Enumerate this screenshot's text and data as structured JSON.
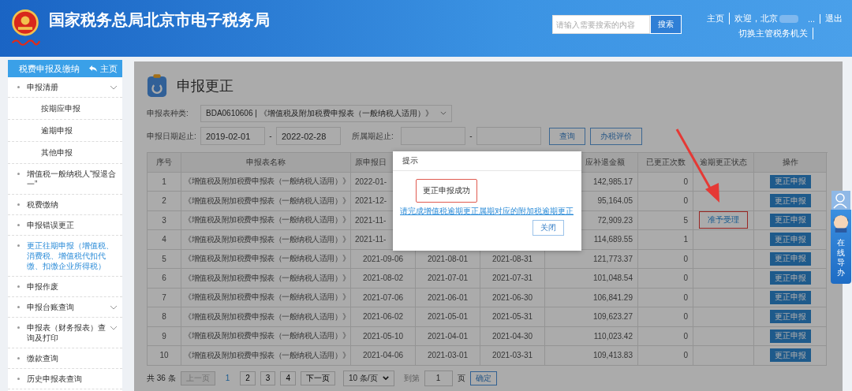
{
  "header": {
    "title": "国家税务总局北京市电子税务局",
    "search": {
      "placeholder": "请输入需要搜索的内容",
      "button": "搜索"
    },
    "links": [
      "主页",
      "欢迎，北京",
      "退出"
    ],
    "name_suffix": "...",
    "switch_link": "切换主管税务机关"
  },
  "sidebar": {
    "title": "税费申报及缴纳",
    "home": "主页",
    "items": [
      {
        "label": "申报清册",
        "expanded": true,
        "selected": false,
        "children": [
          {
            "label": "按期应申报"
          },
          {
            "label": "逾期申报"
          },
          {
            "label": "其他申报"
          }
        ]
      },
      {
        "label": "增值税一般纳税人“报退合一”",
        "selected": false
      },
      {
        "label": "税费缴纳",
        "selected": false
      },
      {
        "label": "申报错误更正",
        "selected": false
      },
      {
        "label": "更正往期申报（增值税、消费税、增值税代扣代缴、扣缴企业所得税）",
        "selected": true
      },
      {
        "label": "申报作废",
        "selected": false
      },
      {
        "label": "申报台账查询",
        "selected": false,
        "expandable": true
      },
      {
        "label": "申报表（财务报表）查询及打印",
        "selected": false,
        "expandable": true
      },
      {
        "label": "缴款查询",
        "selected": false
      },
      {
        "label": "历史申报表查询",
        "selected": false
      }
    ]
  },
  "page": {
    "title": "申报更正",
    "filters": {
      "type_label": "申报表种类:",
      "type_value": "BDA0610606 | 《增值税及附加税费申报表（一般纳税人适用）》",
      "date_label": "申报日期起止:",
      "date_from": "2019-02-01",
      "date_to": "2022-02-28",
      "dash": "-",
      "period_label": "所属期起止:",
      "period_dash": "-",
      "query": "查询",
      "rate": "办税评价"
    },
    "table": {
      "columns": [
        "序号",
        "申报表名称",
        "原申报日",
        "应补退金额",
        "已更正次数",
        "逾期更正状态",
        "操作"
      ],
      "rows": [
        {
          "no": "1",
          "name": "《增值税及附加税费申报表（一般纳税人适用）》",
          "filed": "2022-01-",
          "amount": "142,985.17",
          "count": "0",
          "action": "更正申报"
        },
        {
          "no": "2",
          "name": "《增值税及附加税费申报表（一般纳税人适用）》",
          "filed": "2021-12-",
          "amount": "95,164.05",
          "count": "0",
          "action": "更正申报"
        },
        {
          "no": "3",
          "name": "《增值税及附加税费申报表（一般纳税人适用）》",
          "filed": "2021-11-",
          "amount": "72,909.23",
          "count": "5",
          "status": "准予受理",
          "highlighted": true,
          "action": "更正申报"
        },
        {
          "no": "4",
          "name": "《增值税及附加税费申报表（一般纳税人适用）》",
          "filed": "2021-11-",
          "amount": "114,689.55",
          "count": "1",
          "action": "更正申报"
        },
        {
          "no": "5",
          "name": "《增值税及附加税费申报表（一般纳税人适用）》",
          "filed": "2021-09-06",
          "start": "2021-08-01",
          "end": "2021-08-31",
          "amount": "121,773.37",
          "count": "0",
          "action": "更正申报"
        },
        {
          "no": "6",
          "name": "《增值税及附加税费申报表（一般纳税人适用）》",
          "filed": "2021-08-02",
          "start": "2021-07-01",
          "end": "2021-07-31",
          "amount": "101,048.54",
          "count": "0",
          "action": "更正申报"
        },
        {
          "no": "7",
          "name": "《增值税及附加税费申报表（一般纳税人适用）》",
          "filed": "2021-07-06",
          "start": "2021-06-01",
          "end": "2021-06-30",
          "amount": "106,841.29",
          "count": "0",
          "action": "更正申报"
        },
        {
          "no": "8",
          "name": "《增值税及附加税费申报表（一般纳税人适用）》",
          "filed": "2021-06-02",
          "start": "2021-05-01",
          "end": "2021-05-31",
          "amount": "109,623.27",
          "count": "0",
          "action": "更正申报"
        },
        {
          "no": "9",
          "name": "《增值税及附加税费申报表（一般纳税人适用）》",
          "filed": "2021-05-10",
          "start": "2021-04-01",
          "end": "2021-04-30",
          "amount": "110,023.42",
          "count": "0",
          "action": "更正申报"
        },
        {
          "no": "10",
          "name": "《增值税及附加税费申报表（一般纳税人适用）》",
          "filed": "2021-04-06",
          "start": "2021-03-01",
          "end": "2021-03-31",
          "amount": "109,413.83",
          "count": "0",
          "action": "更正申报"
        }
      ]
    },
    "pagination": {
      "total": "共 36 条",
      "prev": "上一页",
      "pages": [
        {
          "label": "1",
          "selected": true
        },
        {
          "label": "2",
          "selected": false
        },
        {
          "label": "3",
          "selected": false
        },
        {
          "label": "4",
          "selected": false
        }
      ],
      "next": "下一页",
      "page_size": "10 条/页",
      "goto_label": "到第",
      "goto_value": "1",
      "page_unit": "页",
      "confirm": "确定"
    }
  },
  "dialog": {
    "title": "提示",
    "message": "更正申报成功",
    "link": "请完成增值税逾期更正属期对应的附加税逾期更正",
    "close": "关闭"
  },
  "guide": {
    "label": "在线导办"
  }
}
